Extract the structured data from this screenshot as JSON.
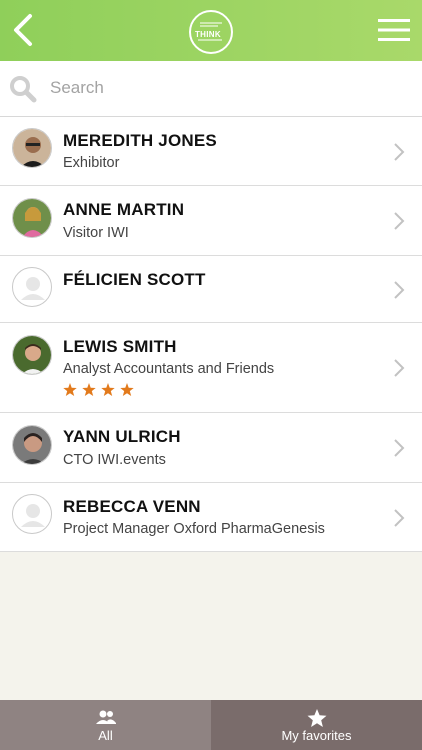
{
  "header": {
    "logo_text": "THINK"
  },
  "search": {
    "placeholder": "Search",
    "value": ""
  },
  "contacts": [
    {
      "name": "MEREDITH JONES",
      "subtitle": "Exhibitor",
      "rating": 0
    },
    {
      "name": "ANNE MARTIN",
      "subtitle": "Visitor IWI",
      "rating": 0
    },
    {
      "name": "FÉLICIEN SCOTT",
      "subtitle": "",
      "rating": 0
    },
    {
      "name": "LEWIS SMITH",
      "subtitle": "Analyst Accountants and Friends",
      "rating": 4
    },
    {
      "name": "YANN ULRICH",
      "subtitle": "CTO IWI.events",
      "rating": 0
    },
    {
      "name": "REBECCA VENN",
      "subtitle": "Project Manager Oxford PharmaGenesis",
      "rating": 0
    }
  ],
  "tabs": {
    "all_label": "All",
    "favorites_label": "My favorites"
  },
  "colors": {
    "header_green": "#9fd463",
    "star_orange": "#e27a1c",
    "tab_active": "#7a6c6b",
    "tab_inactive": "#8f8382"
  },
  "icons": {
    "back": "chevron-left-icon",
    "menu": "hamburger-icon",
    "search": "search-icon",
    "all": "people-icon",
    "favorites": "star-icon"
  }
}
